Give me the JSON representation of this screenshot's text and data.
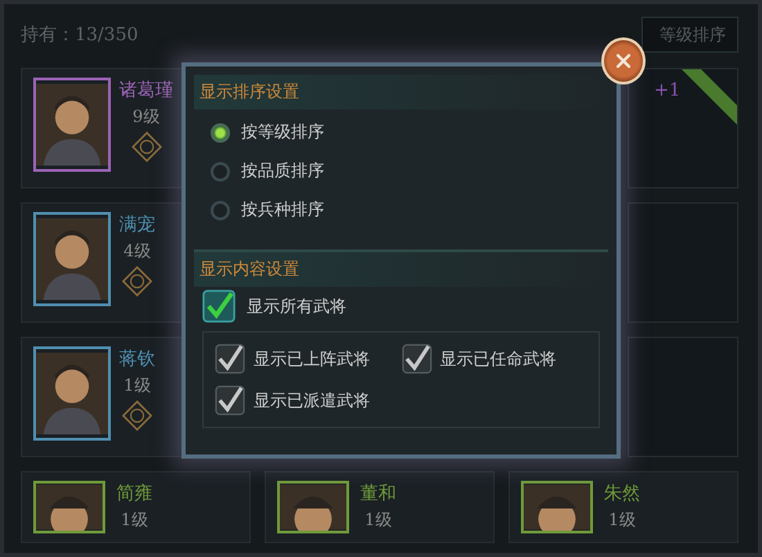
{
  "header": {
    "count_label": "持有：13/350",
    "sort_button": "等级排序"
  },
  "generals": [
    {
      "name": "诸葛瑾",
      "level": "9级",
      "color": "#9b63b5"
    },
    {
      "name": "满宠",
      "level": "4级",
      "color": "#4f8fb0"
    },
    {
      "name": "蒋钦",
      "level": "1级",
      "color": "#4f8fb0"
    }
  ],
  "side_cards": [
    {
      "bonus": "+1",
      "ribbon": true
    },
    {
      "ribbon": false
    },
    {
      "ribbon": false
    }
  ],
  "bottom_generals": [
    {
      "name": "简雍",
      "level": "1级",
      "color": "#6f9a3a"
    },
    {
      "name": "董和",
      "level": "1级",
      "color": "#6f9a3a"
    },
    {
      "name": "朱然",
      "level": "1级",
      "color": "#6f9a3a"
    }
  ],
  "dialog": {
    "sort_section": {
      "title": "显示排序设置",
      "options": [
        {
          "label": "按等级排序",
          "selected": true
        },
        {
          "label": "按品质排序",
          "selected": false
        },
        {
          "label": "按兵种排序",
          "selected": false
        }
      ]
    },
    "content_section": {
      "title": "显示内容设置",
      "all": {
        "label": "显示所有武将",
        "checked": true
      },
      "filters": [
        {
          "label": "显示已上阵武将",
          "checked": true
        },
        {
          "label": "显示已任命武将",
          "checked": true
        },
        {
          "label": "显示已派遣武将",
          "checked": true
        }
      ]
    }
  }
}
